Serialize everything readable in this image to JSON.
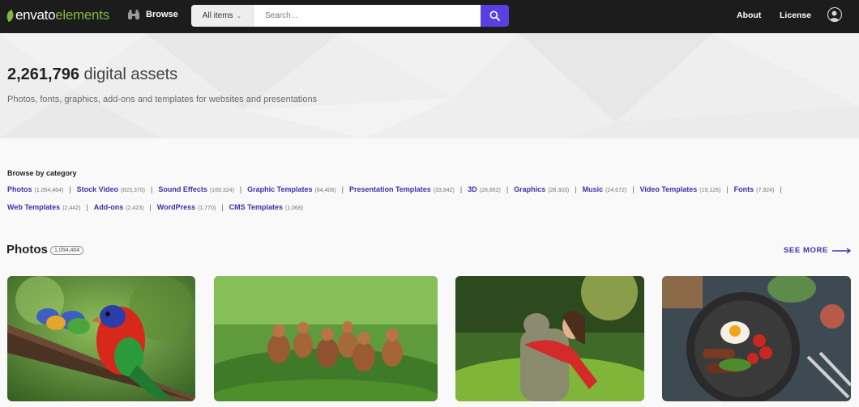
{
  "header": {
    "logo": {
      "part1": "envato",
      "part2": "elements"
    },
    "browse_label": "Browse",
    "search": {
      "category": "All items",
      "placeholder": "Search..."
    },
    "nav": {
      "about": "About",
      "license": "License"
    }
  },
  "hero": {
    "count": "2,261,796",
    "title_suffix": "digital assets",
    "subtitle": "Photos, fonts, graphics, add-ons and templates for websites and presentations"
  },
  "categories": {
    "heading": "Browse by category",
    "row1": [
      {
        "name": "Photos",
        "count": "(1,054,464)"
      },
      {
        "name": "Stock Video",
        "count": "(823,370)"
      },
      {
        "name": "Sound Effects",
        "count": "(169,324)"
      },
      {
        "name": "Graphic Templates",
        "count": "(64,406)"
      },
      {
        "name": "Presentation Templates",
        "count": "(33,842)"
      },
      {
        "name": "3D",
        "count": "(28,662)"
      },
      {
        "name": "Graphics",
        "count": "(28,303)"
      },
      {
        "name": "Music",
        "count": "(24,672)"
      },
      {
        "name": "Video Templates",
        "count": "(19,126)"
      },
      {
        "name": "Fonts",
        "count": "(7,924)"
      }
    ],
    "row2": [
      {
        "name": "Web Templates",
        "count": "(2,442)"
      },
      {
        "name": "Add-ons",
        "count": "(2,423)"
      },
      {
        "name": "WordPress",
        "count": "(1,770)"
      },
      {
        "name": "CMS Templates",
        "count": "(1,068)"
      }
    ]
  },
  "section": {
    "title": "Photos",
    "count": "1,054,464",
    "see_more": "SEE MORE"
  },
  "colors": {
    "header_bg": "#1c1c1c",
    "brand_green": "#82b541",
    "search_button": "#5b3fe0",
    "link_purple": "#3b33a8"
  },
  "icons": [
    "binoculars-icon",
    "chevron-down-icon",
    "search-icon",
    "user-avatar-icon",
    "arrow-right-icon"
  ]
}
